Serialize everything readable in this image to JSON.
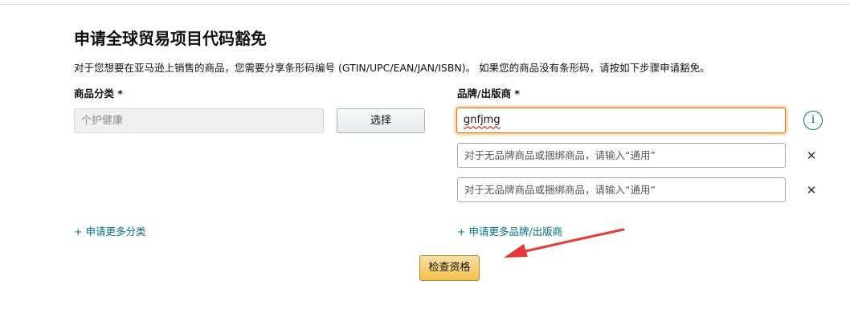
{
  "page": {
    "title": "申请全球贸易项目代码豁免",
    "description": "对于您想要在亚马逊上销售的商品，您需要分享条形码编号 (GTIN/UPC/EAN/JAN/ISBN)。 如果您的商品没有条形码，请按如下步骤申请豁免。"
  },
  "category": {
    "label": "商品分类 *",
    "placeholder": "个护健康",
    "select_button": "选择",
    "add_more_link": "+ 申请更多分类"
  },
  "brand": {
    "label": "品牌/出版商 *",
    "inputs": [
      {
        "value": "gnfjmg",
        "placeholder": ""
      },
      {
        "value": "",
        "placeholder": "对于无品牌商品或捆绑商品，请输入“通用”"
      },
      {
        "value": "",
        "placeholder": "对于无品牌商品或捆绑商品，请输入“通用”"
      }
    ],
    "info_icon": "i",
    "remove_icon": "✕",
    "add_more_link": "+ 申请更多品牌/出版商"
  },
  "actions": {
    "check_button": "检查资格"
  },
  "icons": {
    "info": "info-icon",
    "remove": "close-icon",
    "annotation": "red-arrow"
  },
  "colors": {
    "link": "#007185",
    "focus_border": "#e77600",
    "primary_button": "#f0c14b",
    "annotation_arrow": "#e53935"
  }
}
